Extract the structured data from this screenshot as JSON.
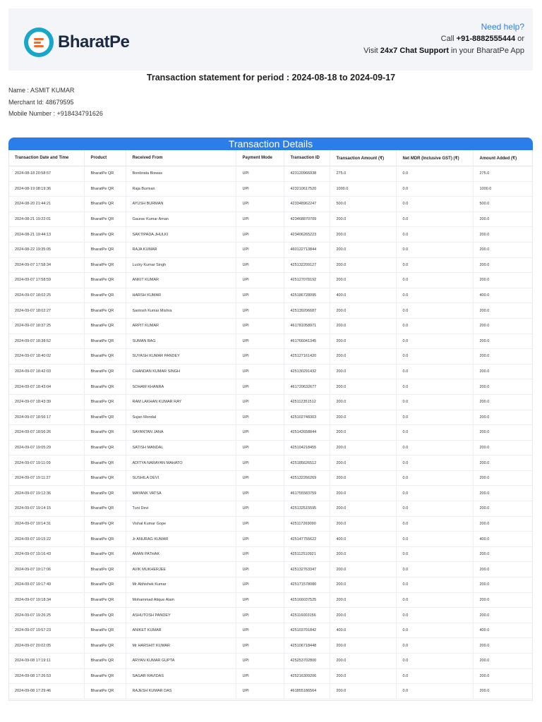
{
  "header": {
    "brand": "BharatPe",
    "help_title": "Need help?",
    "call_prefix": "Call ",
    "call_number": "+91-8882555444",
    "call_suffix": " or",
    "visit_prefix": "Visit ",
    "chat_label": "24x7 Chat Support",
    "visit_suffix": " in your BharatPe App"
  },
  "statement": {
    "title": "Transaction statement for period : 2024-08-18 to 2024-09-17",
    "name": "Name : ASMIT KUMAR",
    "merchant_id": "Merchant Id: 48679595",
    "mobile": "Mobile Number : +918434791626"
  },
  "table": {
    "title": "Transaction Details",
    "columns": [
      "Transaction Date and Time",
      "Product",
      "Received From",
      "Payment Mode",
      "Transaction ID",
      "Transaction Amount (₹)",
      "Net MDR (Inclusive GST) (₹)",
      "Amount Added (₹)"
    ],
    "rows": [
      [
        "2024-08-18 20:58:57",
        "BharatPe QR",
        "Bonibrata Biswas",
        "UPI",
        "423120966938",
        "275.0",
        "0.0",
        "275.0"
      ],
      [
        "2024-08-19 08:19:36",
        "BharatPe QR",
        "Raja Burman",
        "UPI",
        "423210617520",
        "1000.0",
        "0.0",
        "1000.0"
      ],
      [
        "2024-08-20 21:44:21",
        "BharatPe QR",
        "AYUSH BURMAN",
        "UPI",
        "423348962247",
        "500.0",
        "0.0",
        "500.0"
      ],
      [
        "2024-08-21 19:22:01",
        "BharatPe QR",
        "Gaurav Kumar Aman",
        "UPI",
        "423468870709",
        "200.0",
        "0.0",
        "200.0"
      ],
      [
        "2024-08-21 19:44:13",
        "BharatPe QR",
        "SAKTIPADA JHULKI",
        "UPI",
        "423406265223",
        "200.0",
        "0.0",
        "200.0"
      ],
      [
        "2024-08-22 19:35:05",
        "BharatPe QR",
        "RAJA KUMAR",
        "UPI",
        "460122713844",
        "200.0",
        "0.0",
        "200.0"
      ],
      [
        "2024-09-07 17:58:34",
        "BharatPe QR",
        "Lucky Kumar Singh",
        "UPI",
        "425132209127",
        "200.0",
        "0.0",
        "200.0"
      ],
      [
        "2024-09-07 17:58:59",
        "BharatPe QR",
        "ANKIT KUMAR",
        "UPI",
        "425127078192",
        "200.0",
        "0.0",
        "200.0"
      ],
      [
        "2024-09-07 18:02:25",
        "BharatPe QR",
        "HARSH KUMAR",
        "UPI",
        "425186728095",
        "400.0",
        "0.0",
        "400.0"
      ],
      [
        "2024-09-07 18:02:27",
        "BharatPe QR",
        "Santosh Kumar Mishra",
        "UPI",
        "425139206687",
        "200.0",
        "0.0",
        "200.0"
      ],
      [
        "2024-09-07 18:37:25",
        "BharatPe QR",
        "ARPIT KUMAR",
        "UPI",
        "461781058971",
        "200.0",
        "0.0",
        "200.0"
      ],
      [
        "2024-09-07 18:38:52",
        "BharatPe QR",
        "SUMAN BAG",
        "UPI",
        "461766041345",
        "200.0",
        "0.0",
        "200.0"
      ],
      [
        "2024-09-07 18:40:02",
        "BharatPe QR",
        "SUYASH KUMAR PANDEY",
        "UPI",
        "425127161420",
        "200.0",
        "0.0",
        "200.0"
      ],
      [
        "2024-09-07 18:42:03",
        "BharatPe QR",
        "CHANDAN KUMAR SINGH",
        "UPI",
        "425130291432",
        "200.0",
        "0.0",
        "200.0"
      ],
      [
        "2024-09-07 18:43:04",
        "BharatPe QR",
        "SOHAM KHANRA",
        "UPI",
        "461720632677",
        "200.0",
        "0.0",
        "200.0"
      ],
      [
        "2024-09-07 18:43:39",
        "BharatPe QR",
        "RAM LAKHAN KUMAR RAY",
        "UPI",
        "425112351512",
        "200.0",
        "0.0",
        "200.0"
      ],
      [
        "2024-09-07 18:56:17",
        "BharatPe QR",
        "Sujan Mondal",
        "UPI",
        "425102748303",
        "200.0",
        "0.0",
        "200.0"
      ],
      [
        "2024-09-07 18:56:26",
        "BharatPe QR",
        "SAYANTAN JANA",
        "UPI",
        "425142658844",
        "200.0",
        "0.0",
        "200.0"
      ],
      [
        "2024-09-07 19:05:29",
        "BharatPe QR",
        "SATISH MANDAL",
        "UPI",
        "425104218455",
        "200.0",
        "0.0",
        "200.0"
      ],
      [
        "2024-09-07 19:11:09",
        "BharatPe QR",
        "ADITYA NARAYAN MAHATO",
        "UPI",
        "425185626512",
        "200.0",
        "0.0",
        "200.0"
      ],
      [
        "2024-09-07 19:11:27",
        "BharatPe QR",
        "SUSHILA DEVI",
        "UPI",
        "425132266269",
        "200.0",
        "0.0",
        "200.0"
      ],
      [
        "2024-09-07 19:12:36",
        "BharatPe QR",
        "MAYANK VATSA",
        "UPI",
        "461755583759",
        "200.0",
        "0.0",
        "200.0"
      ],
      [
        "2024-09-07 19:14:15",
        "BharatPe QR",
        "Tuni Devi",
        "UPI",
        "425132515595",
        "200.0",
        "0.0",
        "200.0"
      ],
      [
        "2024-09-07 19:14:31",
        "BharatPe QR",
        "Vishal Kumar Gope",
        "UPI",
        "425117269090",
        "200.0",
        "0.0",
        "200.0"
      ],
      [
        "2024-09-07 19:15:22",
        "BharatPe QR",
        "Jr ANURAG KUMAR",
        "UPI",
        "425147755622",
        "400.0",
        "0.0",
        "400.0"
      ],
      [
        "2024-09-07 19:16:43",
        "BharatPe QR",
        "AMAN PATHAK",
        "UPI",
        "425112510921",
        "200.0",
        "0.0",
        "200.0"
      ],
      [
        "2024-09-07 19:17:06",
        "BharatPe QR",
        "AVIK MUKHERJEE",
        "UPI",
        "425132763347",
        "200.0",
        "0.0",
        "200.0"
      ],
      [
        "2024-09-07 19:17:49",
        "BharatPe QR",
        "Mr Abhishek Kumar",
        "UPI",
        "425171578080",
        "200.0",
        "0.0",
        "200.0"
      ],
      [
        "2024-09-07 19:18:34",
        "BharatPe QR",
        "Mohammad Atique Alam",
        "UPI",
        "425166037525",
        "200.0",
        "0.0",
        "200.0"
      ],
      [
        "2024-09-07 19:26:25",
        "BharatPe QR",
        "ASHUTOSH PANDEY",
        "UPI",
        "425116003156",
        "200.0",
        "0.0",
        "200.0"
      ],
      [
        "2024-09-07 19:57:23",
        "BharatPe QR",
        "ANIKET KUMAR",
        "UPI",
        "425103701842",
        "400.0",
        "0.0",
        "400.0"
      ],
      [
        "2024-09-07 20:02:05",
        "BharatPe QR",
        "Mr HARSHIT KUMAR",
        "UPI",
        "425106718448",
        "200.0",
        "0.0",
        "200.0"
      ],
      [
        "2024-09-08 17:19:11",
        "BharatPe QR",
        "ARYAN KUMAR GUPTA",
        "UPI",
        "425253702800",
        "200.0",
        "0.0",
        "200.0"
      ],
      [
        "2024-09-08 17:26:53",
        "BharatPe QR",
        "SAGAR RAVIDAS",
        "UPI",
        "425216309206",
        "200.0",
        "0.0",
        "200.0"
      ],
      [
        "2024-09-08 17:29:46",
        "BharatPe QR",
        "RAJESH KUMAR DAS",
        "UPI",
        "461855186564",
        "200.0",
        "0.0",
        "200.0"
      ]
    ]
  },
  "colors": {
    "accent": "#2b7de9",
    "brand_teal": "#18a7c9",
    "brand_orange": "#f26a2a",
    "header_bg": "#f3f5f9"
  },
  "icons": {
    "logo": "bharatpe-logo-icon"
  }
}
